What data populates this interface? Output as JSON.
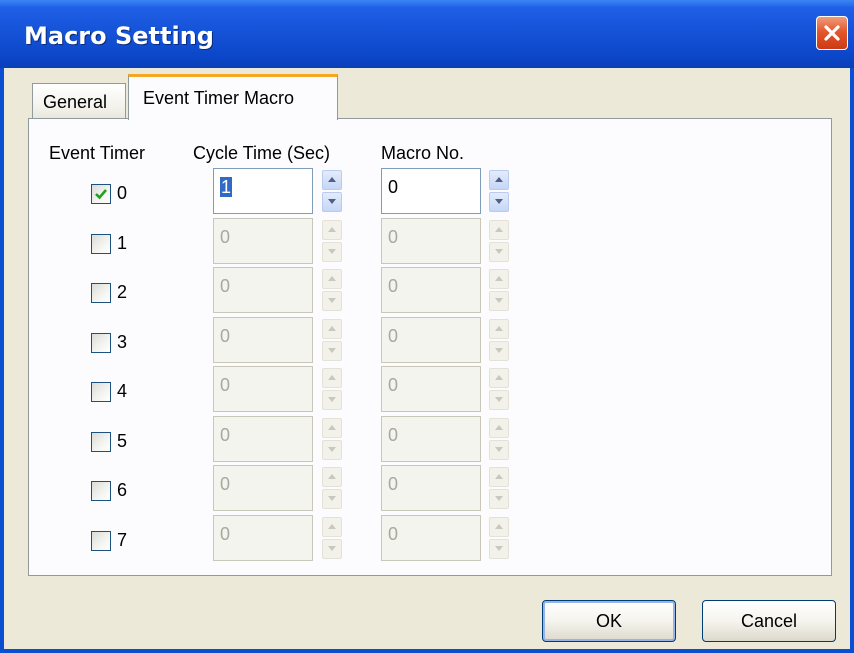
{
  "window": {
    "title": "Macro Setting",
    "close_icon": "close-icon"
  },
  "tabs": [
    {
      "label": "General",
      "active": false
    },
    {
      "label": "Event Timer Macro",
      "active": true
    }
  ],
  "headers": {
    "event_timer": "Event Timer",
    "cycle_time": "Cycle Time (Sec)",
    "macro_no": "Macro No."
  },
  "timers": [
    {
      "label": "0",
      "checked": true,
      "cycle_time": "1",
      "macro_no": "0",
      "enabled": true
    },
    {
      "label": "1",
      "checked": false,
      "cycle_time": "0",
      "macro_no": "0",
      "enabled": false
    },
    {
      "label": "2",
      "checked": false,
      "cycle_time": "0",
      "macro_no": "0",
      "enabled": false
    },
    {
      "label": "3",
      "checked": false,
      "cycle_time": "0",
      "macro_no": "0",
      "enabled": false
    },
    {
      "label": "4",
      "checked": false,
      "cycle_time": "0",
      "macro_no": "0",
      "enabled": false
    },
    {
      "label": "5",
      "checked": false,
      "cycle_time": "0",
      "macro_no": "0",
      "enabled": false
    },
    {
      "label": "6",
      "checked": false,
      "cycle_time": "0",
      "macro_no": "0",
      "enabled": false
    },
    {
      "label": "7",
      "checked": false,
      "cycle_time": "0",
      "macro_no": "0",
      "enabled": false
    }
  ],
  "buttons": {
    "ok": "OK",
    "cancel": "Cancel"
  },
  "colors": {
    "titlebar": "#1553d8",
    "dialog_bg": "#ece9d8",
    "active_tab_accent": "#f5a623",
    "check": "#21a121"
  }
}
